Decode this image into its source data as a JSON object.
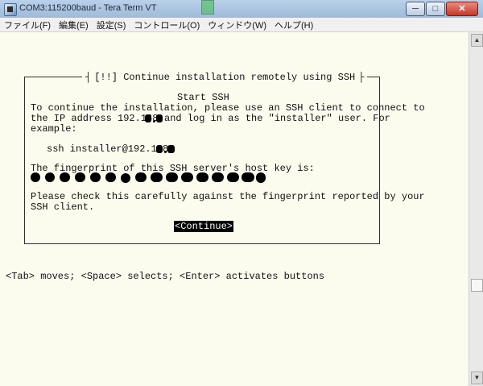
{
  "window": {
    "title": "COM3:115200baud - Tera Term VT",
    "buttons": {
      "minimize": "─",
      "maximize": "□",
      "close": "✕"
    }
  },
  "menu": [
    "ファイル(F)",
    "編集(E)",
    "設定(S)",
    "コントロール(O)",
    "ウィンドウ(W)",
    "ヘルプ(H)"
  ],
  "dialog": {
    "title": "[!!] Continue installation remotely using SSH",
    "heading": "Start SSH",
    "lines": [
      "To continue the installation, please use an SSH client to connect to",
      "the IP address 192.168.",
      "and log in as the \"installer\" user. For",
      "example:",
      "ssh installer@192.168.",
      "The fingerprint of this SSH server's host key is:",
      "Please check this carefully against the fingerprint reported by your",
      "SSH client."
    ],
    "continue_label": "<Continue>"
  },
  "status_line": "<Tab> moves; <Space> selects; <Enter> activates buttons",
  "colors": {
    "terminal_bg": "#fcfcee",
    "text": "#101010",
    "button_bg": "#000000",
    "button_fg": "#ffffff"
  }
}
